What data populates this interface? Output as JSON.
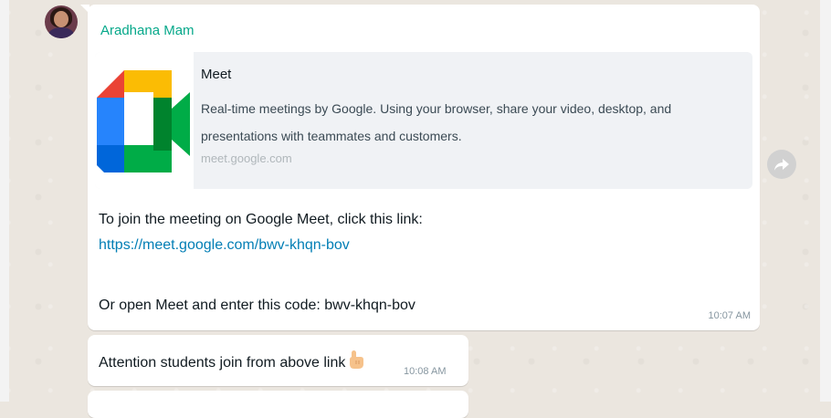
{
  "chat": {
    "sender_name": "Aradhana Mam",
    "link_preview": {
      "title": "Meet",
      "description_line1": "Real-time meetings by Google. Using your browser, share your video, desktop, and",
      "description_line2": "presentations with teammates and customers.",
      "domain": "meet.google.com",
      "thumbnail_icon": "google-meet-logo"
    },
    "message_lines": {
      "join_text": "To join the meeting on Google Meet, click this link:",
      "link": "https://meet.google.com/bwv-khqn-bov",
      "code_text": "Or open Meet and enter this code: bwv-khqn-bov"
    },
    "message_time": "10:07 AM",
    "second_message": {
      "text": "Attention students join from above link",
      "emoji_icon": "pointing-up-hand-icon",
      "time": "10:08 AM"
    },
    "forward_icon": "forward-arrow-icon"
  },
  "colors": {
    "sender": "#06a88a",
    "link": "#027eb5",
    "wallpaper": "#ebe6df",
    "bubble": "#ffffff",
    "preview_card": "#f0f2f5"
  }
}
